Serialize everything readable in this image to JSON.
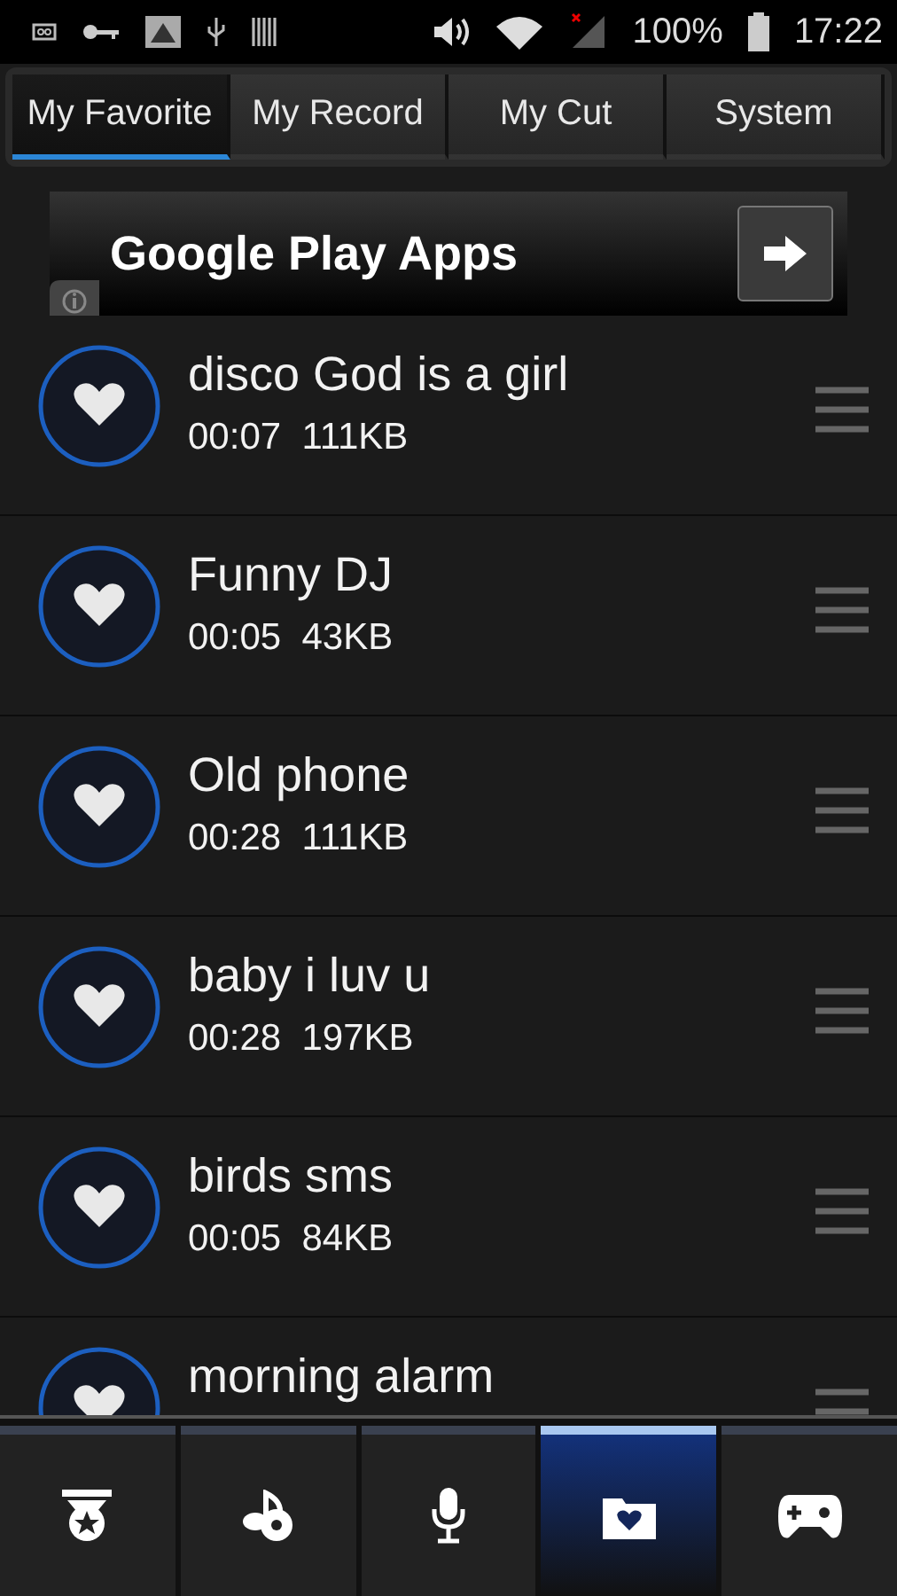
{
  "status_bar": {
    "battery": "100%",
    "time": "17:22"
  },
  "tabs": [
    {
      "label": "My Favorite",
      "selected": true
    },
    {
      "label": "My Record",
      "selected": false
    },
    {
      "label": "My Cut",
      "selected": false
    },
    {
      "label": "System",
      "selected": false
    }
  ],
  "ad": {
    "title": "Google Play Apps"
  },
  "items": [
    {
      "title": "disco God is a girl",
      "duration": "00:07",
      "size": "111KB"
    },
    {
      "title": "Funny DJ",
      "duration": "00:05",
      "size": "43KB"
    },
    {
      "title": "Old phone",
      "duration": "00:28",
      "size": "111KB"
    },
    {
      "title": "baby i luv u",
      "duration": "00:28",
      "size": "197KB"
    },
    {
      "title": "birds sms",
      "duration": "00:05",
      "size": "84KB"
    },
    {
      "title": "morning alarm"
    }
  ],
  "nav": [
    {
      "kind": "medal",
      "selected": false
    },
    {
      "kind": "music",
      "selected": false
    },
    {
      "kind": "mic",
      "selected": false
    },
    {
      "kind": "folder",
      "selected": true
    },
    {
      "kind": "gamepad",
      "selected": false
    }
  ]
}
